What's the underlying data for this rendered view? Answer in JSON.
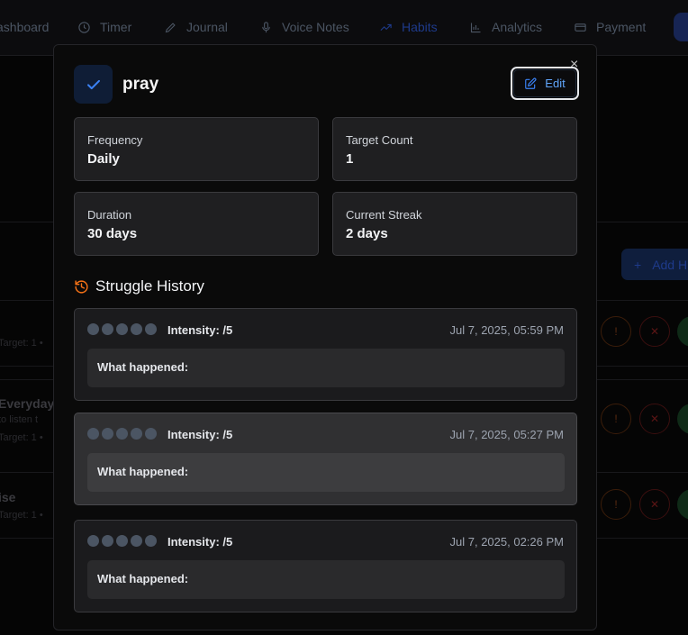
{
  "nav": {
    "items": [
      {
        "label": "ashboard"
      },
      {
        "label": "Timer"
      },
      {
        "label": "Journal"
      },
      {
        "label": "Voice Notes"
      },
      {
        "label": "Habits"
      },
      {
        "label": "Analytics"
      },
      {
        "label": "Payment"
      }
    ]
  },
  "background": {
    "add_button_label": "Add H",
    "rows": [
      {
        "title": "",
        "subtitle": "",
        "meta": "Target: 1 •"
      },
      {
        "title": "Everyday",
        "subtitle": "to listen t",
        "meta": "Target: 1 •"
      },
      {
        "title": "ise",
        "subtitle": "",
        "meta": "Target: 1 •"
      }
    ]
  },
  "modal": {
    "title": "pray",
    "close_glyph": "×",
    "edit_label": "Edit",
    "stats": [
      {
        "label": "Frequency",
        "value": "Daily"
      },
      {
        "label": "Target Count",
        "value": "1"
      },
      {
        "label": "Duration",
        "value": "30 days"
      },
      {
        "label": "Current Streak",
        "value": "2 days"
      }
    ],
    "history_title": "Struggle History",
    "history": [
      {
        "intensity": "Intensity: /5",
        "timestamp": "Jul 7, 2025, 05:59 PM",
        "what_happened": "What happened:"
      },
      {
        "intensity": "Intensity: /5",
        "timestamp": "Jul 7, 2025, 05:27 PM",
        "what_happened": "What happened:"
      },
      {
        "intensity": "Intensity: /5",
        "timestamp": "Jul 7, 2025, 02:26 PM",
        "what_happened": "What happened:"
      }
    ]
  },
  "colors": {
    "accent": "#3b82f6",
    "history_icon": "#f97316"
  },
  "icons": {
    "habit": "check-icon",
    "edit": "edit-icon",
    "history": "history-icon"
  }
}
